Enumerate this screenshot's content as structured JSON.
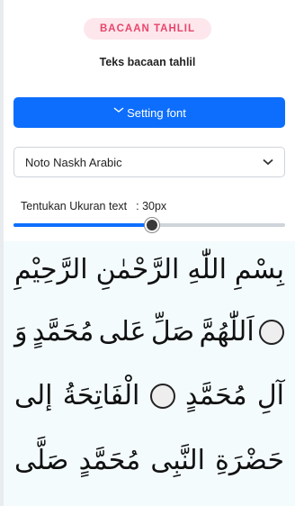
{
  "header": {
    "badge": "BACAAN TAHLIL",
    "subtitle": "Teks bacaan tahlil"
  },
  "setting_button": {
    "label": "Setting font",
    "icon": "chevron-down-icon"
  },
  "font_select": {
    "value": "Noto Naskh Arabic",
    "icon": "chevron-down-icon"
  },
  "size": {
    "label": "Tentukan Ukuran text",
    "value": ": 30px",
    "slider_fraction": 0.51
  },
  "colors": {
    "accent": "#0d6efd",
    "badge_text": "#e8456b",
    "badge_bg": "#fde7ec",
    "text_bg": "#f3fbfd"
  },
  "arabic": {
    "line1": [
      "بِسْمِ",
      "اللّٰهِ",
      "الرَّحْمٰنِ",
      "الرَّحِيْمِ"
    ],
    "line2": [
      "اَللّٰهُمَّ",
      "صَلِّ",
      "عَلى",
      "مُحَمَّدٍ",
      "وَ"
    ],
    "line3": [
      "آلِ",
      "مُحَمَّدٍ",
      "الْفَاتِحَةُ",
      "إلى"
    ],
    "line4": [
      "حَضْرَةِ",
      "النَّبِى",
      "مُحَمَّدٍ",
      "صَلَّى"
    ]
  }
}
